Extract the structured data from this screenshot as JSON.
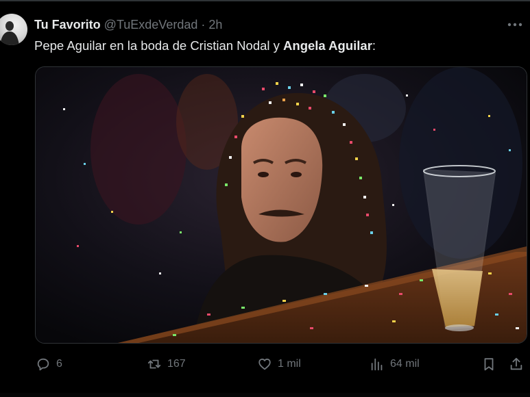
{
  "tweet": {
    "author": {
      "display_name": "Tu Favorito",
      "handle": "@TuExdeVerdad",
      "separator": "·",
      "time": "2h"
    },
    "text_plain": "Pepe Aguilar en la boda de Cristian Nodal y ",
    "text_bold": "Angela Aguilar",
    "text_tail": ":",
    "more_icon": "ellipsis-icon"
  },
  "actions": {
    "reply": {
      "icon": "reply-icon",
      "count": "6"
    },
    "retweet": {
      "icon": "retweet-icon",
      "count": "167"
    },
    "like": {
      "icon": "heart-icon",
      "count": "1 mil"
    },
    "views": {
      "icon": "views-icon",
      "count": "64 mil"
    },
    "bookmark": {
      "icon": "bookmark-icon"
    },
    "share": {
      "icon": "share-icon"
    }
  },
  "colors": {
    "background": "#000000",
    "text_primary": "#e7e9ea",
    "text_secondary": "#71767b",
    "border": "#2f3336"
  }
}
